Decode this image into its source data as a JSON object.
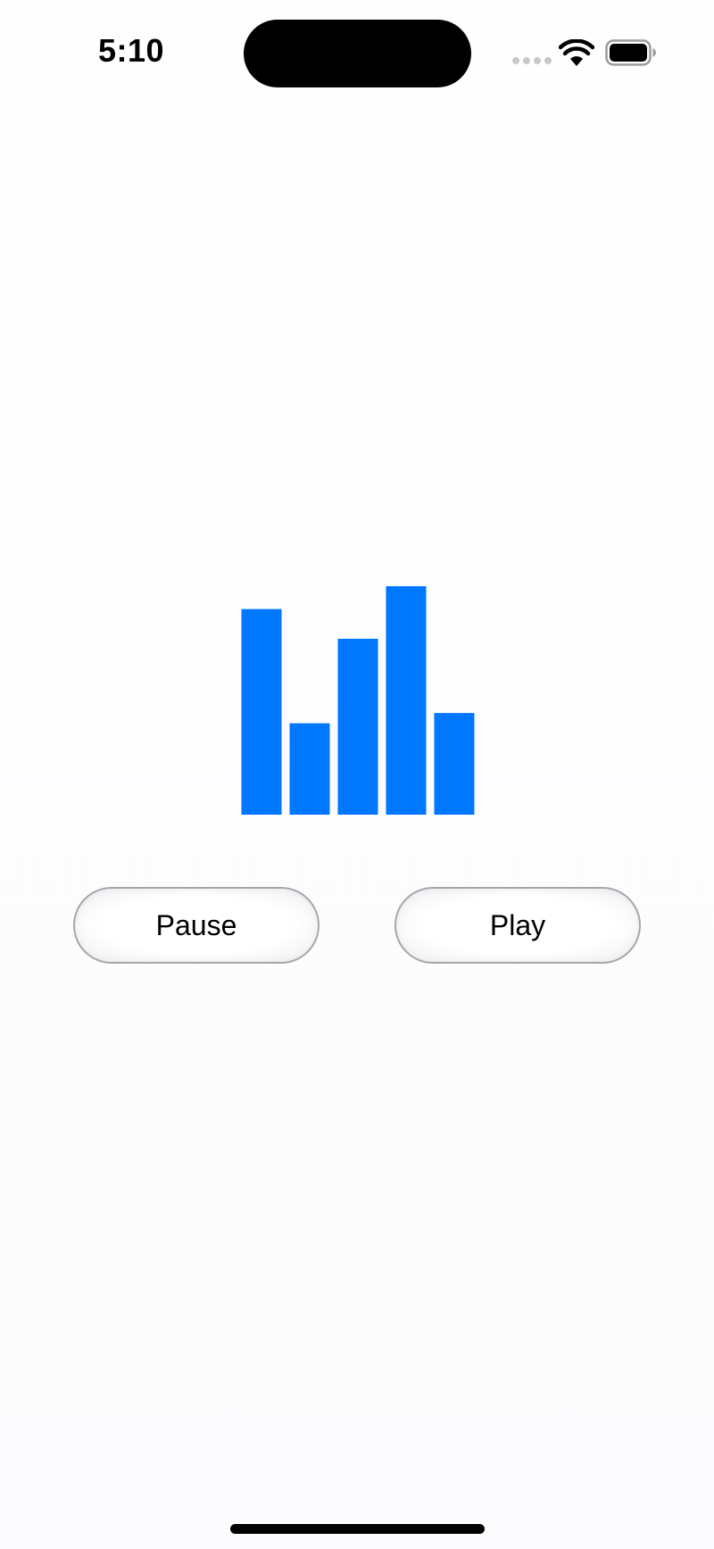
{
  "status_bar": {
    "time": "5:10",
    "icons": [
      "cellular-signal-icon",
      "wifi-icon",
      "battery-icon"
    ]
  },
  "visualizer": {
    "bar_color": "#0077ff",
    "levels": [
      0.9,
      0.4,
      0.77,
      1.0,
      0.445
    ]
  },
  "controls": {
    "pause_label": "Pause",
    "play_label": "Play"
  }
}
